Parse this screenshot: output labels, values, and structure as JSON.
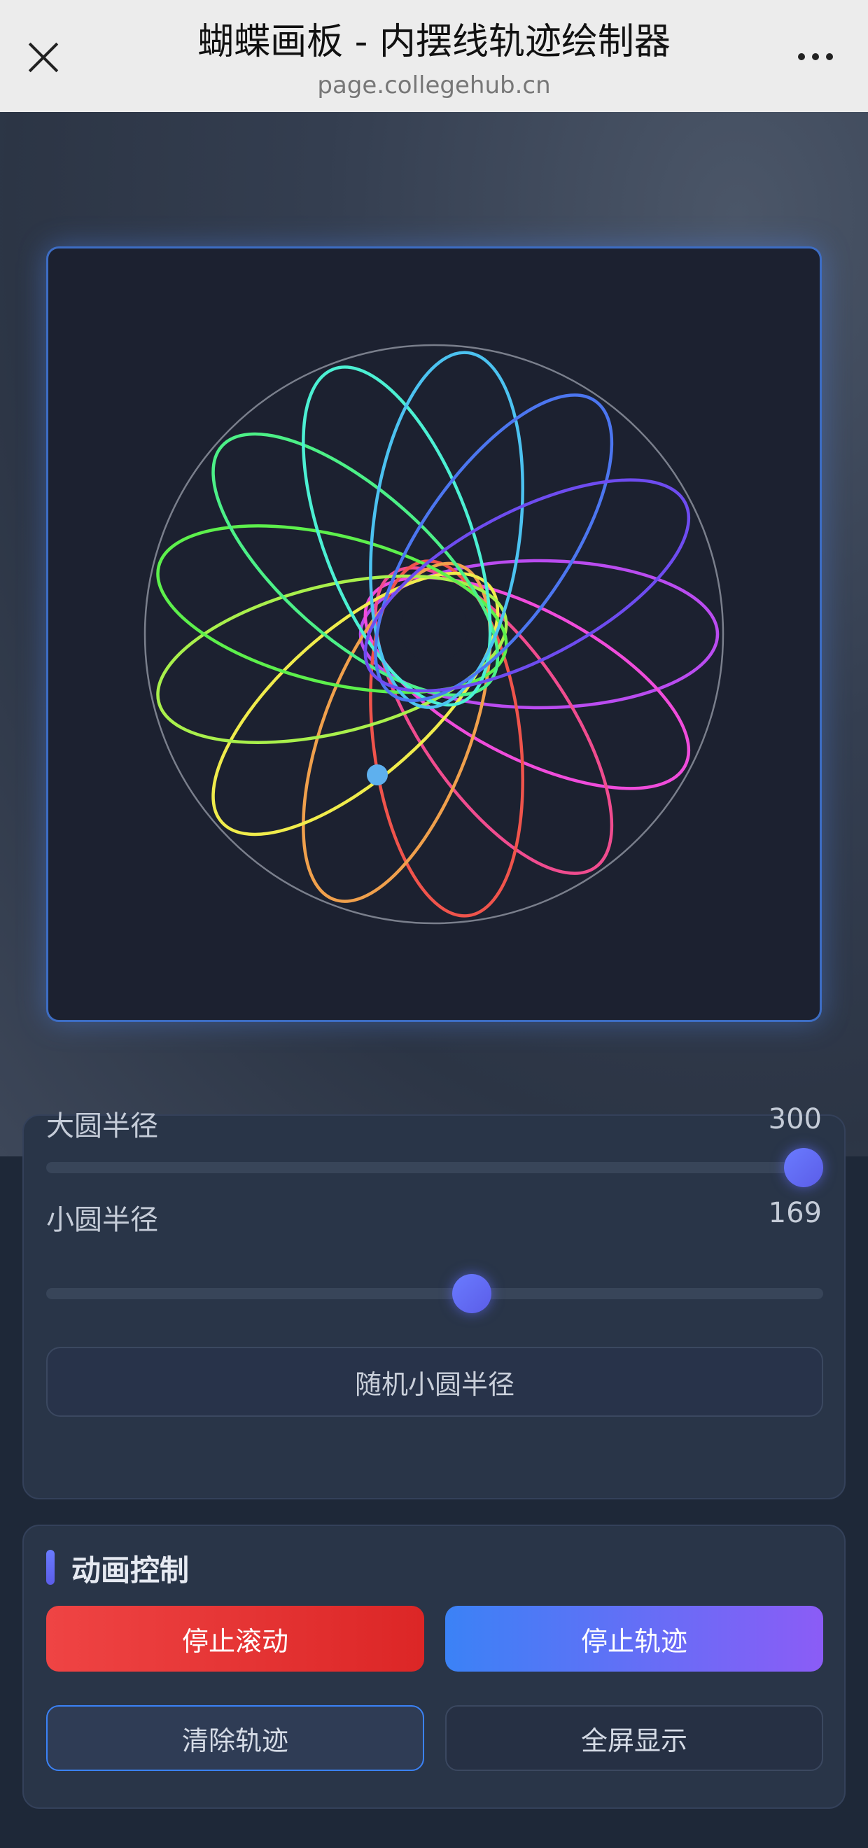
{
  "browser": {
    "title": "蝴蝶画板 - 内摆线轨迹绘制器",
    "url": "page.collegehub.cn"
  },
  "sliders": {
    "big_radius": {
      "label": "大圆半径",
      "value": "300",
      "fraction": 1.0
    },
    "small_radius": {
      "label": "小圆半径",
      "value": "169",
      "fraction": 0.55
    }
  },
  "buttons": {
    "random_small_radius": "随机小圆半径",
    "stop_rolling": "停止滚动",
    "stop_trace": "停止轨迹",
    "clear_trace": "清除轨迹",
    "fullscreen": "全屏显示"
  },
  "animation_section": {
    "title": "动画控制"
  },
  "colors": {
    "accent": "#5b5de8",
    "stop_rolling": "#ef4444",
    "stop_trace_from": "#3b82f6",
    "stop_trace_to": "#8b5cf6",
    "canvas_bg": "#1c2130"
  },
  "icons": {
    "close": "close-icon",
    "more": "more-icon"
  }
}
